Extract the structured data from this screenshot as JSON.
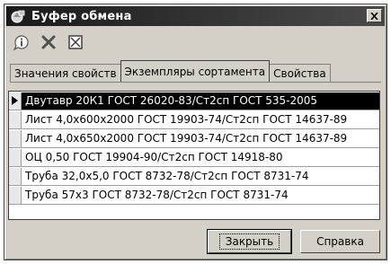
{
  "window": {
    "title": "Буфер обмена"
  },
  "toolbar": {
    "icons": [
      "info-icon",
      "delete-icon",
      "clear-icon"
    ]
  },
  "tabs": [
    {
      "label": "Значения свойств"
    },
    {
      "label": "Экземпляры сортамента"
    },
    {
      "label": "Свойства"
    }
  ],
  "rows": [
    {
      "text": "Двутавр 20К1 ГОСТ 26020-83/Ст2сп ГОСТ 535-2005"
    },
    {
      "text": "Лист 4,0х600х2000 ГОСТ 19903-74/Ст2сп ГОСТ 14637-89"
    },
    {
      "text": "Лист 4,0х650х2000 ГОСТ 19903-74/Ст2сп ГОСТ 14637-89"
    },
    {
      "text": "ОЦ 0,50 ГОСТ 19904-90/Ст2сп ГОСТ 14918-80"
    },
    {
      "text": "Труба 32,0х5,0 ГОСТ 8732-78/Ст2сп ГОСТ 8731-74"
    },
    {
      "text": "Труба 57х3 ГОСТ 8732-78/Ст2сп ГОСТ 8731-74"
    }
  ],
  "buttons": {
    "close": "Закрыть",
    "help": "Справка"
  }
}
